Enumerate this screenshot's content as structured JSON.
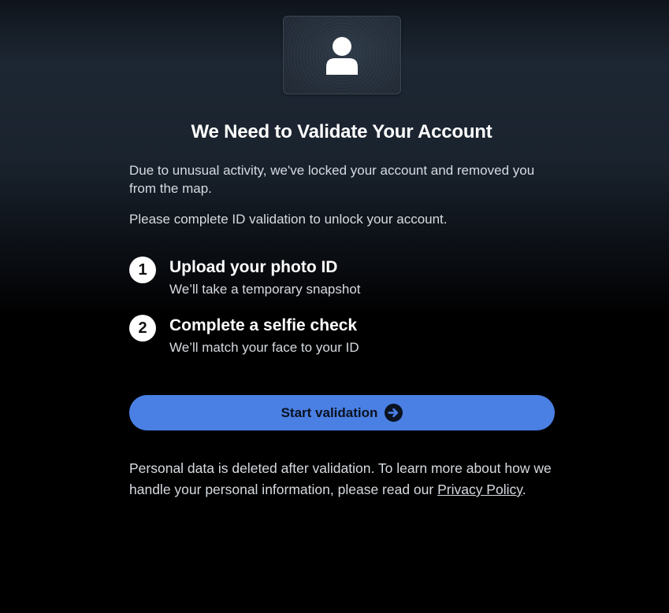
{
  "header": {
    "icon": "user-id-card-icon",
    "title": "We Need to Validate Your Account"
  },
  "body": {
    "paragraph1": "Due to unusual activity, we've locked your account and removed you from the map.",
    "paragraph2": "Please complete ID validation to unlock your account."
  },
  "steps": [
    {
      "number": "1",
      "title": "Upload your photo ID",
      "subtitle": "We’ll take a temporary snapshot"
    },
    {
      "number": "2",
      "title": "Complete a selfie check",
      "subtitle": "We’ll match your face to your ID"
    }
  ],
  "button": {
    "label": "Start validation",
    "icon": "arrow-right-circle-icon",
    "color": "#4a7fe3"
  },
  "footer": {
    "text_before": "Personal data is deleted after validation. To learn more about how we handle your personal information, please read our ",
    "link": "Privacy Policy",
    "text_after": "."
  }
}
